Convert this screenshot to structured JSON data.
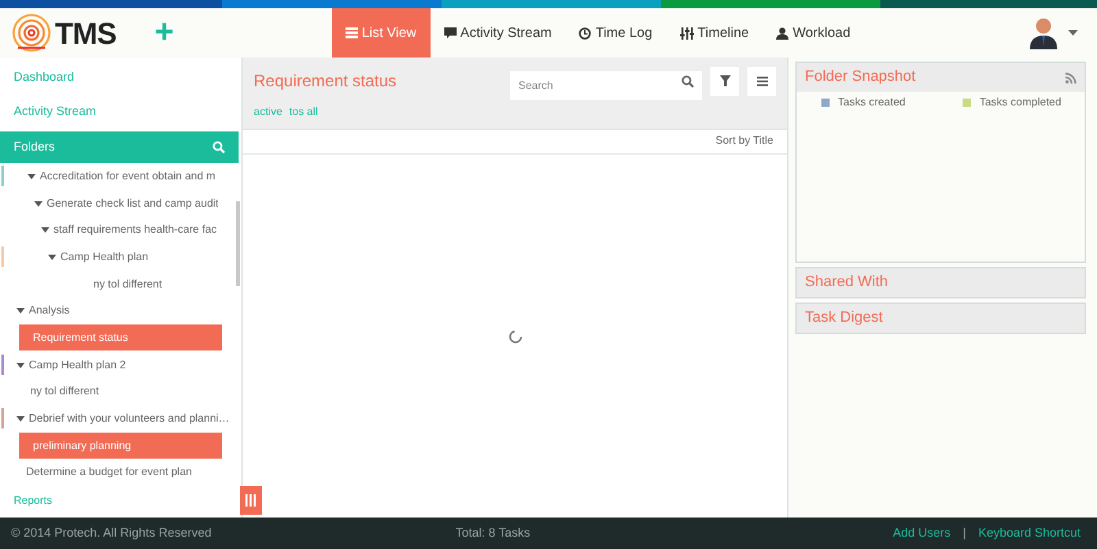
{
  "header": {
    "logo_text": "TMS",
    "add_label": "+",
    "nav": [
      {
        "label": "List View",
        "selected": true
      },
      {
        "label": "Activity Stream",
        "selected": false
      },
      {
        "label": "Time Log",
        "selected": false
      },
      {
        "label": "Timeline",
        "selected": false
      },
      {
        "label": "Workload",
        "selected": false
      }
    ]
  },
  "sidebar": {
    "links": [
      "Dashboard",
      "Activity Stream"
    ],
    "folders_title": "Folders",
    "tree": [
      {
        "label": "Accreditation for event obtain and m",
        "color": "#8ccfd0",
        "children": [
          {
            "label": "Generate check list and camp audit",
            "children": [
              {
                "label": "staff requirements health-care fac",
                "children": [
                  {
                    "label": "Camp Health plan",
                    "color": "#f7c9a4",
                    "children": [
                      {
                        "label": "ny tol different",
                        "selected": false
                      }
                    ]
                  }
                ]
              }
            ]
          }
        ]
      },
      {
        "label": "Analysis",
        "children": [
          {
            "label": "Requirement status",
            "selected": true
          }
        ]
      },
      {
        "label": "Camp Health plan 2",
        "color": "#a98ad0",
        "children": [
          {
            "label": "ny tol different",
            "selected": false
          }
        ]
      },
      {
        "label": "Debrief with your volunteers and planni…",
        "color": "#d2a58e",
        "children": [
          {
            "label": "preliminary planning",
            "selected": true
          }
        ]
      },
      {
        "label": "Determine a budget for event plan",
        "selected": false
      }
    ],
    "reports": "Reports"
  },
  "main": {
    "title": "Requirement status",
    "search": {
      "placeholder": "Search"
    },
    "filters": [
      "active",
      "tos all"
    ],
    "sort": "Sort by Title"
  },
  "right": {
    "panels": [
      {
        "title": "Folder Snapshot",
        "legend": [
          {
            "label": "Tasks created",
            "color": "#8fa8c8"
          },
          {
            "label": "Tasks completed",
            "color": "#c8dc84"
          }
        ]
      },
      {
        "title": "Shared With"
      },
      {
        "title": "Task Digest"
      }
    ]
  },
  "footer": {
    "copyright": "© 2014 Protech. All Rights Reserved",
    "total": "Total: 8 Tasks",
    "links": [
      "Add Users",
      "Keyboard Shortcut"
    ],
    "separator": "|"
  }
}
